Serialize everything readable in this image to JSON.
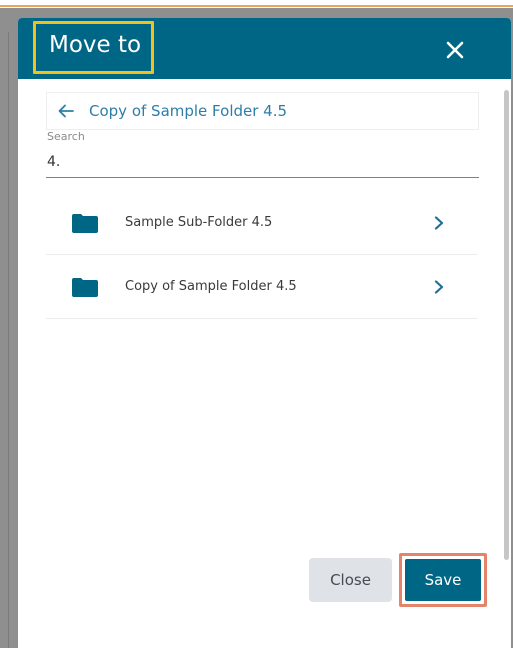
{
  "dialog": {
    "title": "Move to",
    "close_icon": "close-icon",
    "colors": {
      "header": "#006685",
      "title_highlight": "#f3c21a",
      "save_highlight": "#e4846a",
      "link": "#2c7ea8",
      "folder_icon": "#006685"
    }
  },
  "navigation": {
    "back_icon": "arrow-left-icon",
    "current_folder": "Copy of Sample Folder 4.5"
  },
  "search": {
    "label": "Search",
    "value": "4."
  },
  "folders": [
    {
      "name": "Sample Sub-Folder 4.5",
      "icon": "folder-icon",
      "action_icon": "chevron-right-icon"
    },
    {
      "name": "Copy of Sample Folder 4.5",
      "icon": "folder-icon",
      "action_icon": "chevron-right-icon"
    }
  ],
  "actions": {
    "close_label": "Close",
    "save_label": "Save"
  }
}
